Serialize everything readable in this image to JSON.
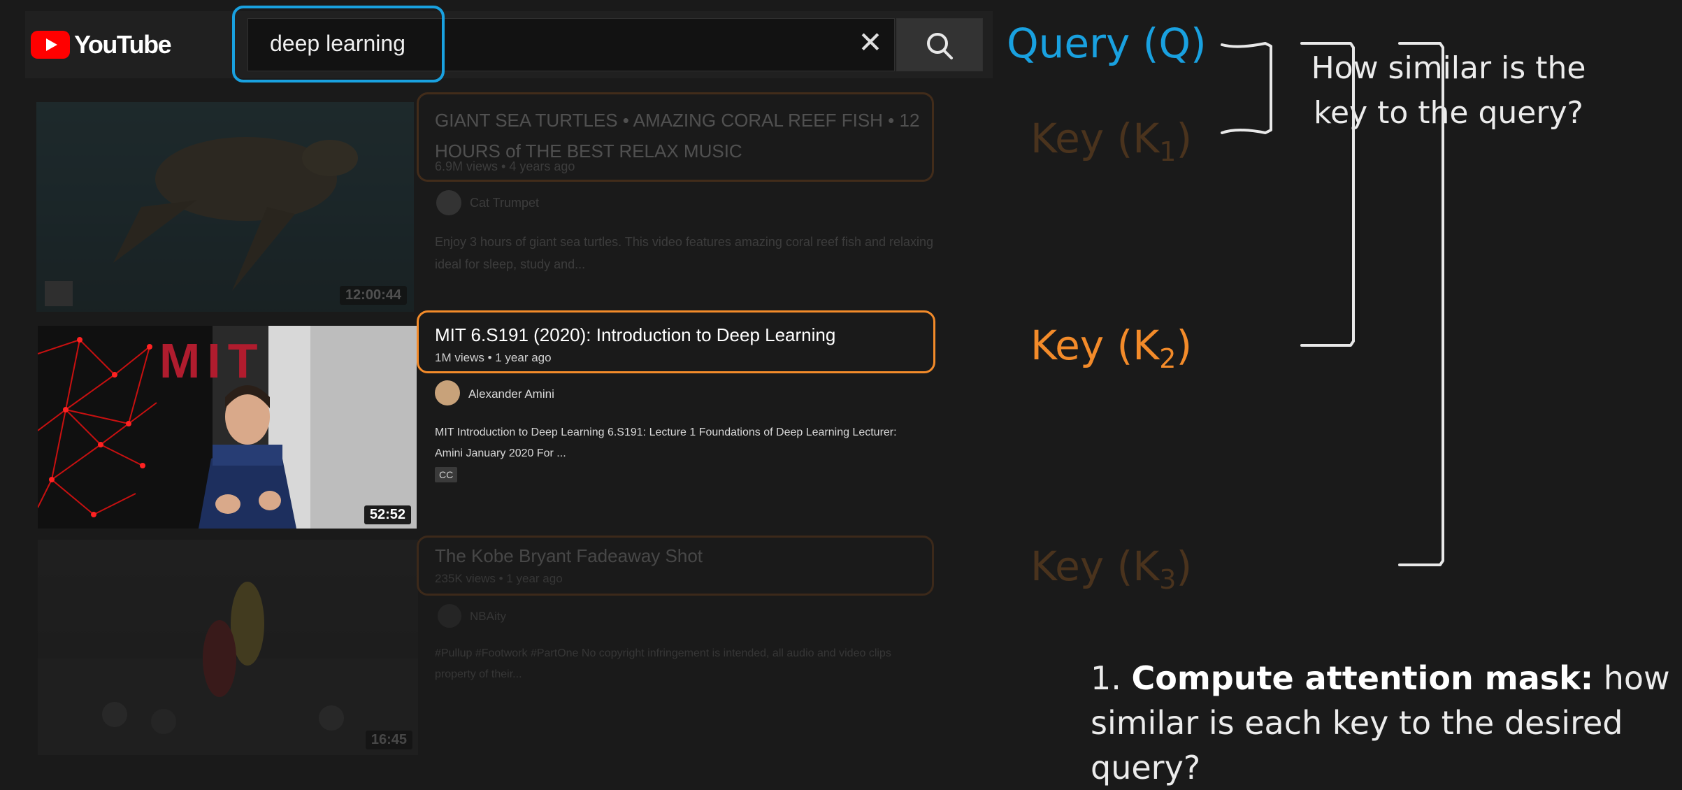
{
  "header": {
    "logo_text": "YouTube",
    "search_value": "deep learning",
    "clear_icon": "close-icon",
    "search_icon": "search-icon"
  },
  "results": [
    {
      "title_line1": "GIANT SEA TURTLES • AMAZING CORAL REEF FISH • 12",
      "title_line2": "HOURS of THE BEST RELAX MUSIC",
      "meta": "6.9M views • 4 years ago",
      "channel": "Cat Trumpet",
      "desc_line1": "Enjoy 3 hours of giant sea turtles. This video features amazing coral reef fish and relaxing",
      "desc_line2": "ideal for sleep, study and...",
      "duration": "12:00:44"
    },
    {
      "title": "MIT 6.S191 (2020): Introduction to Deep Learning",
      "meta": "1M views • 1 year ago",
      "channel": "Alexander Amini",
      "desc_line1": "MIT Introduction to Deep Learning 6.S191: Lecture 1 Foundations of Deep Learning Lecturer:",
      "desc_line2": "Amini January 2020 For ...",
      "badge": "CC",
      "duration": "52:52",
      "thumb_logo": "MIT"
    },
    {
      "title": "The Kobe Bryant Fadeaway Shot",
      "meta": "235K views • 1 year ago",
      "channel": "NBAity",
      "desc_line1": "#Pullup #Footwork #PartOne No copyright infringement is intended, all audio and video clips",
      "desc_line2": "property of their...",
      "duration": "16:45"
    }
  ],
  "annotations": {
    "query": "Query (Q)",
    "key1": {
      "prefix": "Key (K",
      "sub": "1",
      "suffix": ")"
    },
    "key2": {
      "prefix": "Key (K",
      "sub": "2",
      "suffix": ")"
    },
    "key3": {
      "prefix": "Key (K",
      "sub": "3",
      "suffix": ")"
    },
    "question_line1": "How similar is the",
    "question_line2": "key to the query?",
    "step_number": "1.",
    "step_bold": "Compute attention mask:",
    "step_rest_line1": " how",
    "step_line2": "similar is each key to the desired query?"
  },
  "colors": {
    "query_blue": "#19a1e0",
    "key_orange": "#f38b2a",
    "youtube_red": "#ff0000",
    "background": "#1a1a1a"
  }
}
